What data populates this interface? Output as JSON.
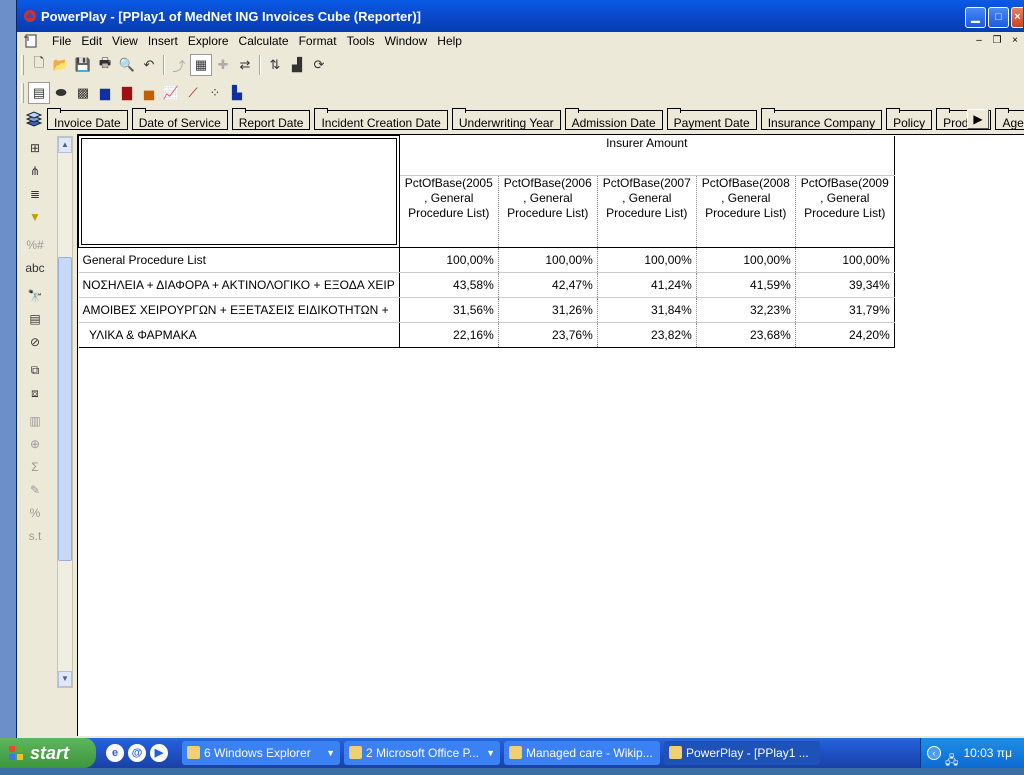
{
  "window": {
    "title": "PowerPlay - [PPlay1 of MedNet ING Invoices Cube (Reporter)]"
  },
  "menu": [
    "File",
    "Edit",
    "View",
    "Insert",
    "Explore",
    "Calculate",
    "Format",
    "Tools",
    "Window",
    "Help"
  ],
  "dimension_tabs": [
    "Invoice Date",
    "Date of Service",
    "Report Date",
    "Incident Creation Date",
    "Underwriting Year",
    "Admission Date",
    "Payment Date",
    "Insurance Company",
    "Policy",
    "Product",
    "Age"
  ],
  "crosstab": {
    "measure": "Insurer Amount",
    "columns": [
      {
        "l1": "PctOfBase(2005",
        "l2": ", General",
        "l3": "Procedure List)"
      },
      {
        "l1": "PctOfBase(2006",
        "l2": ", General",
        "l3": "Procedure List)"
      },
      {
        "l1": "PctOfBase(2007",
        "l2": ", General",
        "l3": "Procedure List)"
      },
      {
        "l1": "PctOfBase(2008",
        "l2": ", General",
        "l3": "Procedure List)"
      },
      {
        "l1": "PctOfBase(2009",
        "l2": ", General",
        "l3": "Procedure List)"
      }
    ],
    "rows": [
      {
        "label": "General Procedure List",
        "values": [
          "100,00%",
          "100,00%",
          "100,00%",
          "100,00%",
          "100,00%"
        ]
      },
      {
        "label": "ΝΟΣΗΛΕΙΑ + ΔΙΑΦΟΡΑ + ΑΚΤΙΝΟΛΟΓΙΚΟ + ΕΞΟΔΑ ΧΕΙΡ",
        "values": [
          "43,58%",
          "42,47%",
          "41,24%",
          "41,59%",
          "39,34%"
        ]
      },
      {
        "label": "ΑΜΟΙΒΕΣ ΧΕΙΡΟΥΡΓΩΝ + ΕΞΕΤΑΣΕΙΣ ΕΙΔΙΚΟΤΗΤΩΝ +",
        "values": [
          "31,56%",
          "31,26%",
          "31,84%",
          "32,23%",
          "31,79%"
        ]
      },
      {
        "label": "  ΥΛΙΚΑ & ΦΑΡΜΑΚΑ",
        "values": [
          "22,16%",
          "23,76%",
          "23,82%",
          "23,68%",
          "24,20%"
        ]
      }
    ]
  },
  "taskbar": {
    "start": "start",
    "tasks": [
      "6 Windows Explorer",
      "2 Microsoft Office P...",
      "Managed care - Wikip...",
      "PowerPlay - [PPlay1 ..."
    ],
    "clock": "10:03 πμ"
  }
}
